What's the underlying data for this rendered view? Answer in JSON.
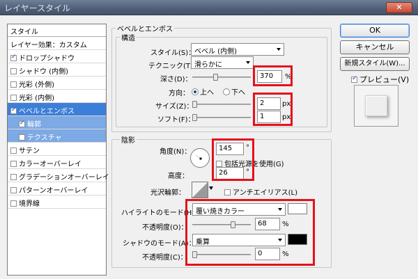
{
  "window": {
    "title": "レイヤースタイル",
    "close": "✕"
  },
  "sidebar": {
    "header": "スタイル",
    "items": [
      {
        "label": "レイヤー効果：カスタム",
        "checkbox": false
      },
      {
        "label": "ドロップシャドウ",
        "checked": true
      },
      {
        "label": "シャドウ (内側)",
        "checked": false
      },
      {
        "label": "光彩 (外側)",
        "checked": false
      },
      {
        "label": "光彩 (内側)",
        "checked": false
      },
      {
        "label": "ベベルとエンボス",
        "checked": true
      },
      {
        "label": "輪郭",
        "checked": true
      },
      {
        "label": "テクスチャ",
        "checked": false
      },
      {
        "label": "サテン",
        "checked": false
      },
      {
        "label": "カラーオーバーレイ",
        "checked": false
      },
      {
        "label": "グラデーションオーバーレイ",
        "checked": false
      },
      {
        "label": "パターンオーバーレイ",
        "checked": false
      },
      {
        "label": "境界線",
        "checked": false
      }
    ]
  },
  "bevel": {
    "section_title": "ベベルとエンボス",
    "structure_title": "構造",
    "style_label": "スタイル(S)：",
    "style_value": "ベベル (内側)",
    "technique_label": "テクニック(T)：",
    "technique_value": "滑らかに",
    "depth_label": "深さ(D)：",
    "depth_value": "370",
    "depth_unit": "%",
    "direction_label": "方向：",
    "direction_up": "上へ",
    "direction_down": "下へ",
    "size_label": "サイズ(Z)：",
    "size_value": "2",
    "size_unit": "px",
    "soften_label": "ソフト(F)：",
    "soften_value": "1",
    "soften_unit": "px"
  },
  "shading": {
    "title": "陰影",
    "angle_label": "角度(N)：",
    "angle_value": "145",
    "angle_unit": "°",
    "global_light_label": "包括光源を使用(G)",
    "altitude_label": "高度：",
    "altitude_value": "26",
    "altitude_unit": "°",
    "gloss_label": "光沢輪郭：",
    "antialias_label": "アンチエイリアス(L)",
    "highlight_mode_label": "ハイライトのモード(H)：",
    "highlight_mode_value": "覆い焼きカラー",
    "highlight_color": "#ffffff",
    "opacity_label": "不透明度(O)：",
    "highlight_opacity": "68",
    "percent": "%",
    "shadow_mode_label": "シャドウのモード(A)：",
    "shadow_mode_value": "乗算",
    "shadow_color": "#000000",
    "shadow_opacity_label": "不透明度(C)：",
    "shadow_opacity": "0"
  },
  "buttons": {
    "ok": "OK",
    "cancel": "キャンセル",
    "new_style": "新規スタイル(W)...",
    "preview_label": "プレビュー(V)"
  },
  "colors": {
    "selection": "#3c7fd8",
    "highlight_box": "#e3121b"
  }
}
